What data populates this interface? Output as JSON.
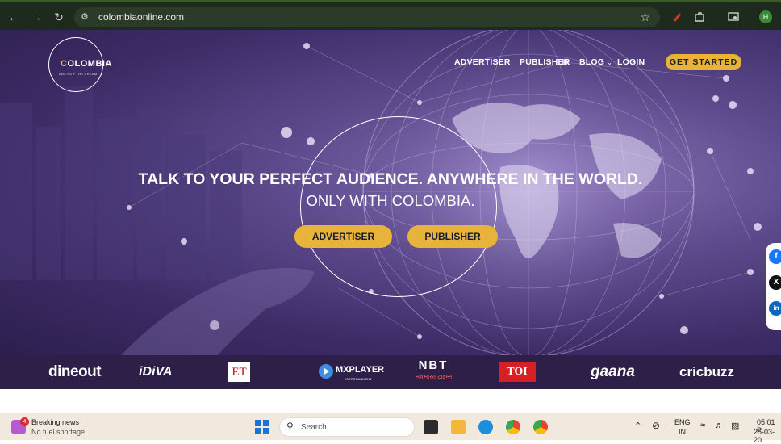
{
  "browser": {
    "url": "colombiaonline.com",
    "profile_initial": "H"
  },
  "site": {
    "logo_text_first": "C",
    "logo_text_rest": "OLOMBIA",
    "logo_tagline": "ADS FOR THE CREAM",
    "nav": {
      "advertiser": "ADVERTISER",
      "publisher": "PUBLISHER",
      "blog": "BLOG",
      "blog_caret": "⌄",
      "login": "LOGIN",
      "get_started": "GET STARTED"
    },
    "hero": {
      "headline_line1": "TALK TO YOUR PERFECT AUDIENCE. ANYWHERE IN THE WORLD.",
      "headline_line2": "ONLY WITH COLOMBIA.",
      "cta_advertiser": "ADVERTISER",
      "cta_publisher": "PUBLISHER"
    },
    "brands": {
      "dineout": "dineout",
      "idiva": "iDiVA",
      "et": "ET",
      "mxplayer": "MXPLAYER",
      "mxplayer_sub": "ENTERTAINMENT",
      "nbt": "NBT",
      "nbt_sub": "नवभारत टाइम्स",
      "toi": "TOI",
      "gaana": "gaana",
      "cricbuzz": "cricbuzz"
    },
    "social": {
      "facebook": "f",
      "x": "X",
      "linkedin": "in"
    }
  },
  "taskbar": {
    "news_badge": "4",
    "news_title": "Breaking news",
    "news_sub": "No fuel shortage...",
    "search_placeholder": "Search",
    "lang_line1": "ENG",
    "lang_line2": "IN",
    "time": "05:01 P",
    "date": "25-03-20"
  },
  "colors": {
    "accent": "#e8b33a",
    "brand_strip": "#2d1f47",
    "hero_purple": "#3d2b66"
  }
}
